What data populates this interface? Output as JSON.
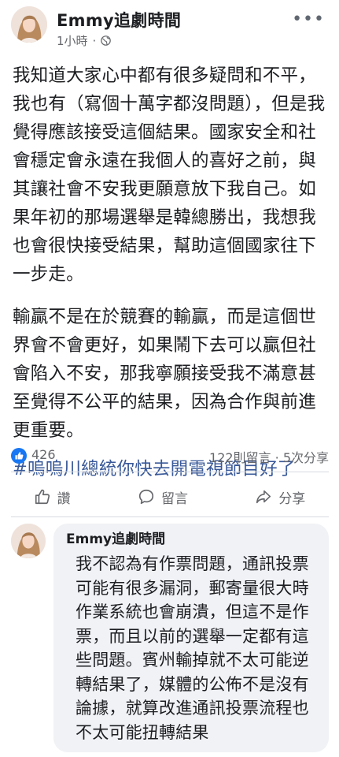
{
  "post": {
    "author": "Emmy追劇時間",
    "time": "1小時",
    "separator": "·",
    "more_label": "•••",
    "paragraphs": [
      "我知道大家心中都有很多疑問和不平，我也有（寫個十萬字都沒問題），但是我覺得應該接受這個結果。國家安全和社會穩定會永遠在我個人的喜好之前，與其讓社會不安我更願意放下我自己。如果年初的那場選舉是韓總勝出，我想我也會很快接受結果，幫助這個國家往下一步走。",
      "輸贏不是在於競賽的輸贏，而是這個世界會不會更好，如果鬧下去可以贏但社會陷入不安，那我寧願接受我不滿意甚至覺得不公平的結果，因為合作與前進更重要。"
    ],
    "hashtag": "#嗚嗚川總統你快去開電視節目好了"
  },
  "stats": {
    "likes": "426",
    "comments_shares": "122則留言 · 5次分享"
  },
  "actions": {
    "like": "讚",
    "comment": "留言",
    "share": "分享"
  },
  "comment": {
    "author": "Emmy追劇時間",
    "text": "我不認為有作票問題，通訊投票可能有很多漏洞，郵寄量很大時作業系統也會崩潰，但這不是作票，而且以前的選舉一定都有這些問題。賓州輸掉就不太可能逆轉結果了，媒體的公佈不是沒有論據，就算改進通訊投票流程也不太可能扭轉結果"
  },
  "colors": {
    "like_blue": "#1877f2",
    "hashtag": "#385898",
    "meta_gray": "#65676b",
    "comment_bg": "#f0f2f5"
  },
  "icons": {
    "privacy": "globe-icon",
    "like_badge": "thumbs-up-icon",
    "like_action": "thumbs-up-outline-icon",
    "comment_action": "speech-bubble-icon",
    "share_action": "share-arrow-icon",
    "more": "more-dots-icon"
  }
}
